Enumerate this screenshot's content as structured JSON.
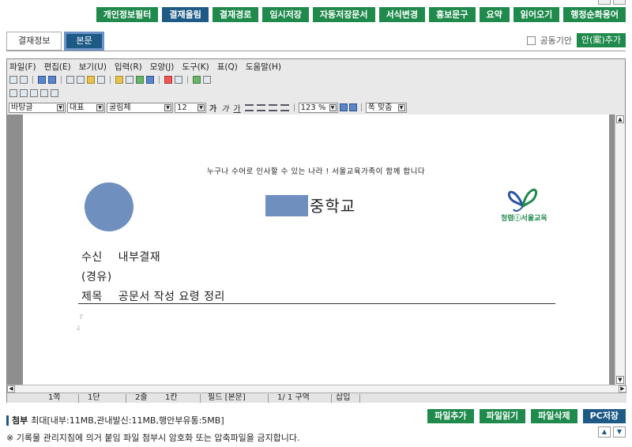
{
  "toolbar": {
    "buttons": [
      {
        "label": "개인정보필터",
        "style": "green"
      },
      {
        "label": "결재올림",
        "style": "dark"
      },
      {
        "label": "결재경로",
        "style": "green"
      },
      {
        "label": "임시저장",
        "style": "green"
      },
      {
        "label": "자동저장문서",
        "style": "green"
      },
      {
        "label": "서식변경",
        "style": "green"
      },
      {
        "label": "홍보문구",
        "style": "green"
      },
      {
        "label": "요약",
        "style": "green"
      },
      {
        "label": "읽어오기",
        "style": "green"
      },
      {
        "label": "행정순화용어",
        "style": "green"
      }
    ]
  },
  "tabs": [
    {
      "label": "결재정보",
      "active": false
    },
    {
      "label": "본문",
      "active": true
    }
  ],
  "options": {
    "joint_draft_label": "공동기안",
    "add_draft_label": "안(案)추가"
  },
  "editor": {
    "menu": [
      "파일(F)",
      "편집(E)",
      "보기(U)",
      "입력(R)",
      "모양(J)",
      "도구(K)",
      "표(Q)",
      "도움말(H)"
    ],
    "format": {
      "style": "바탕글",
      "lang": "대표",
      "font": "굴림체",
      "size": "12",
      "bold_glyph": "가",
      "italic_glyph": "가",
      "underline_glyph": "가",
      "zoom": "123 %",
      "fit": "폭 맞춤"
    },
    "status": {
      "page": "1쪽",
      "section": "1단",
      "line": "2줄",
      "col": "1칸",
      "field": "필드 [본문]",
      "pos": "1/ 1 구역",
      "mode": "삽입"
    }
  },
  "document": {
    "slogan": "누구나 수어로 인사할 수 있는 나라 !  서울교육가족이 함께 합니다",
    "school_name": "중학교",
    "logo_text": "청렴ⓘ서울교육",
    "recipient_label": "수신",
    "recipient_value": "내부결재",
    "via_label": "(경유)",
    "subject_label": "제목",
    "subject_value": "공문서 작성 요령 정리",
    "para_mark_top": "『",
    "para_mark_bottom": "』"
  },
  "attach": {
    "title": "첨부",
    "limits": "최대[내부:11MB,관내발신:11MB,행안부유통:5MB]",
    "buttons": [
      {
        "label": "파일추가",
        "style": "green"
      },
      {
        "label": "파일읽기",
        "style": "green"
      },
      {
        "label": "파일삭제",
        "style": "green"
      },
      {
        "label": "PC저장",
        "style": "dark"
      }
    ],
    "warning": "※ 기록물 관리지침에 의거 붙임 파일 첨부시 암호화 또는 압축파일을 금지합니다."
  },
  "colors": {
    "green": "#1f8a4c",
    "dark": "#1d5a86",
    "placeholder_blue": "#6f8fbf"
  }
}
